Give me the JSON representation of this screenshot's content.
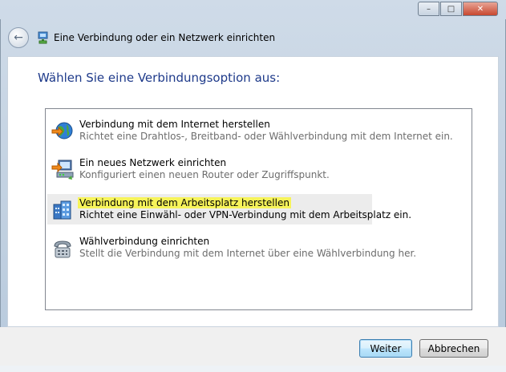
{
  "titlebar": {
    "minimize": "–",
    "maximize": "□",
    "close": "✕"
  },
  "header": {
    "title": "Eine Verbindung oder ein Netzwerk einrichten",
    "back_icon": "back-arrow-icon",
    "app_icon": "network-setup-icon"
  },
  "instruction": "Wählen Sie eine Verbindungsoption aus:",
  "options": [
    {
      "title": "Verbindung mit dem Internet herstellen",
      "desc": "Richtet eine Drahtlos-, Breitband- oder Wählverbindung mit dem Internet ein.",
      "icon": "globe-internet-icon"
    },
    {
      "title": "Ein neues Netzwerk einrichten",
      "desc": "Konfiguriert einen neuen Router oder Zugriffspunkt.",
      "icon": "router-network-icon"
    },
    {
      "title": "Verbindung mit dem Arbeitsplatz herstellen",
      "desc": "Richtet eine Einwähl- oder VPN-Verbindung mit dem Arbeitsplatz ein.",
      "icon": "workplace-building-icon",
      "selected": true
    },
    {
      "title": "Wählverbindung einrichten",
      "desc": "Stellt die Verbindung mit dem Internet über eine Wählverbindung her.",
      "icon": "telephone-dialup-icon"
    }
  ],
  "footer": {
    "next_label": "Weiter",
    "cancel_label": "Abbrechen"
  },
  "colors": {
    "instruction": "#1e3a8a",
    "highlight": "#f7f45a",
    "selected_row": "#ececec"
  }
}
